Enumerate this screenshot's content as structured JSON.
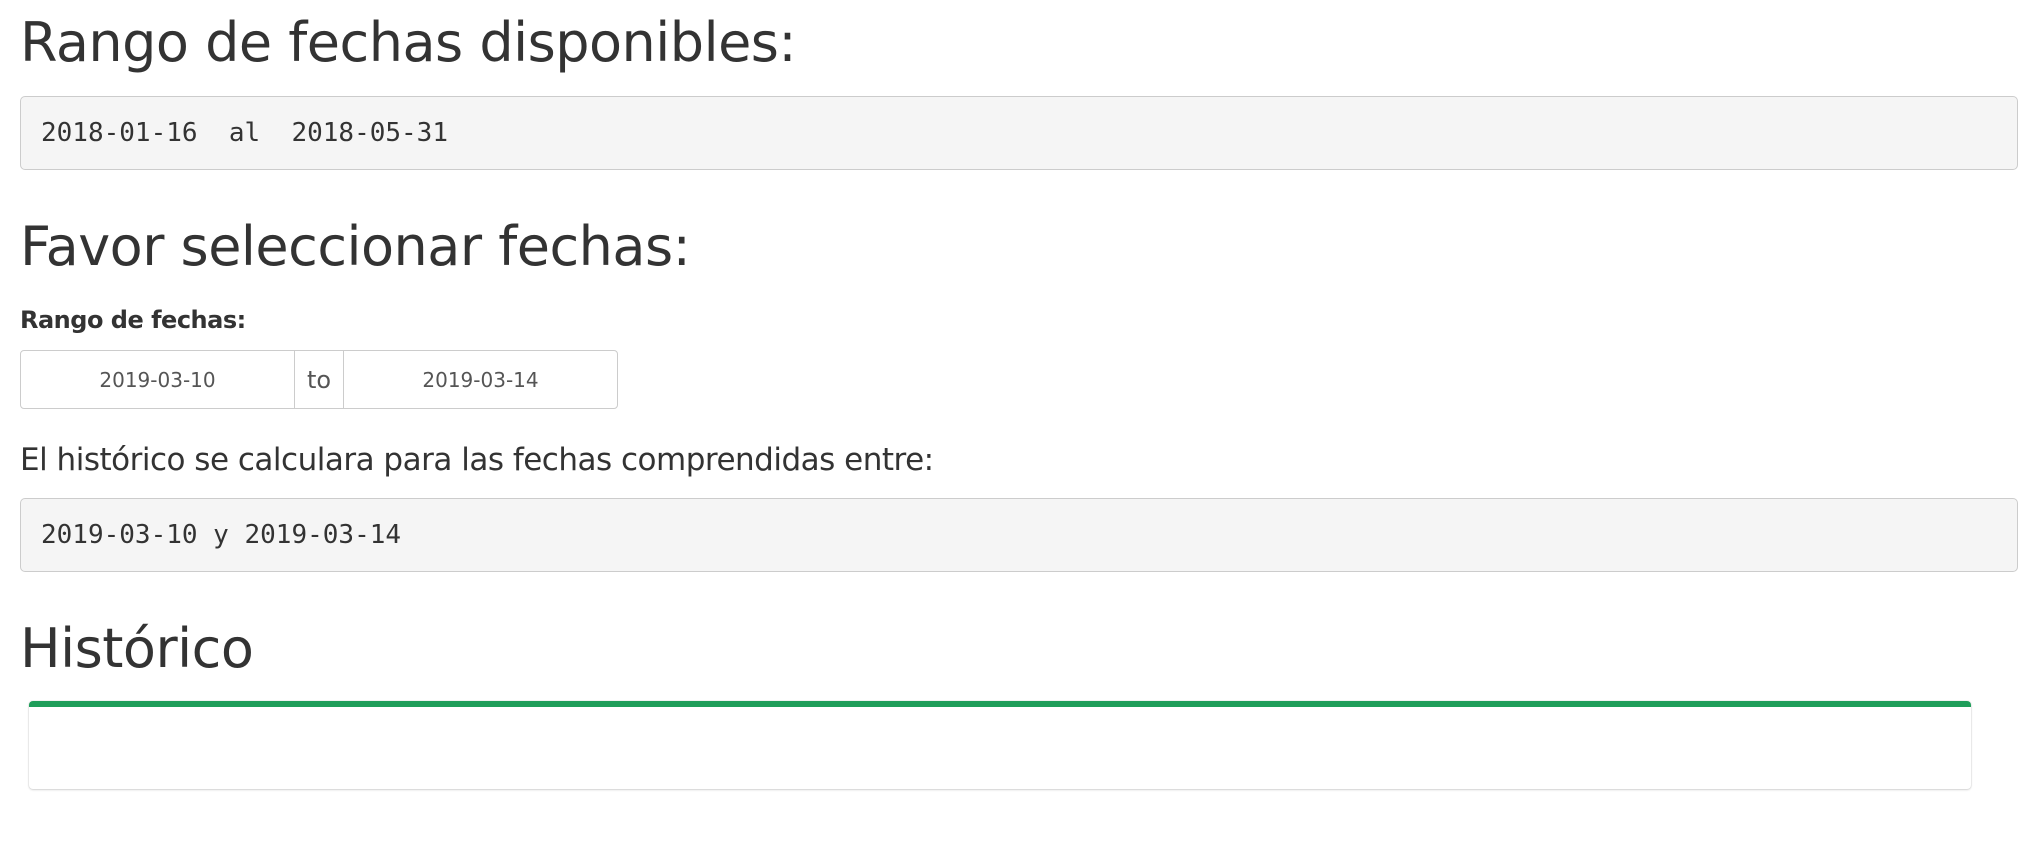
{
  "available_range": {
    "heading": "Rango de fechas disponibles:",
    "text": "2018-01-16  al  2018-05-31"
  },
  "selection": {
    "heading": "Favor seleccionar fechas:",
    "label": "Rango de fechas:",
    "start_value": "2019-03-10",
    "separator": "to",
    "end_value": "2019-03-14"
  },
  "computed": {
    "info_text": "El histórico se calculara para las fechas comprendidas entre:",
    "text": "2019-03-10 y 2019-03-14"
  },
  "historic": {
    "heading": "Histórico",
    "box_accent_color": "#1f9e5a"
  }
}
